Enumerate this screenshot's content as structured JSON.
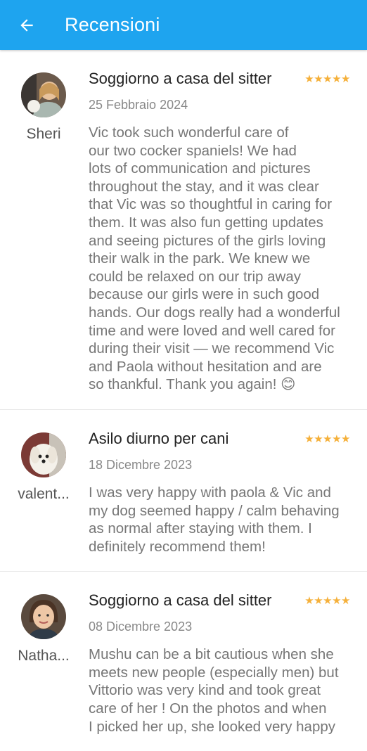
{
  "header": {
    "title": "Recensioni",
    "back_icon": "arrow-left-icon"
  },
  "colors": {
    "appbar": "#1ea4ef",
    "star": "#f5b03a"
  },
  "reviews": [
    {
      "user": "Sheri",
      "title": "Soggiorno a casa del sitter",
      "rating": 5,
      "stars": "★★★★★",
      "date": "25 Febbraio 2024",
      "text": "Vic took such wonderful care of\nour two cocker spaniels! We had\nlots of communication and pictures\nthroughout the stay, and it was clear\nthat Vic was so thoughtful in caring for\nthem. It was also fun getting updates\nand seeing pictures of the girls loving\ntheir walk in the park. We knew we\ncould be relaxed on our trip away\nbecause our girls were in such good\nhands. Our dogs really had a wonderful\ntime and were loved and well cared for\nduring their visit — we recommend Vic\nand Paola without hesitation and are\nso thankful. Thank you again! 😊"
    },
    {
      "user": "valent...",
      "title": "Asilo diurno per cani",
      "rating": 5,
      "stars": "★★★★★",
      "date": "18 Dicembre 2023",
      "text": "I was very happy with paola & Vic and\nmy dog seemed happy / calm behaving\nas normal after staying with them. I\ndefinitely recommend them!"
    },
    {
      "user": "Natha...",
      "title": "Soggiorno a casa del sitter",
      "rating": 5,
      "stars": "★★★★★",
      "date": "08 Dicembre 2023",
      "text": "Mushu can be a bit cautious when she\nmeets new people (especially men) but\nVittorio was very kind and took great\ncare of her ! On the photos and when\nI picked her up, she looked very happy"
    }
  ]
}
